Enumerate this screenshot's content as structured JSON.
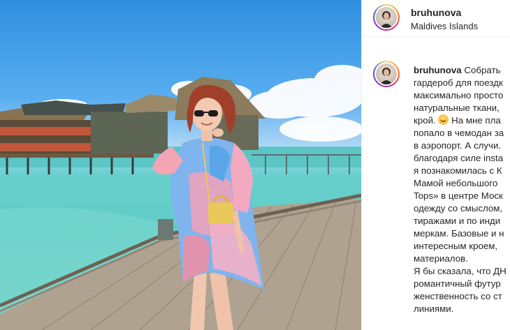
{
  "post": {
    "username": "bruhunova",
    "location": "Maldives Islands"
  },
  "caption": {
    "username": "bruhunova",
    "lines": [
      "Собрать",
      "гардероб для поездк",
      "максимально просто",
      "натуральные ткани,",
      "крой.",
      "На мне пла",
      "попало в чемодан за",
      "в аэропорт. А случи.",
      "благодаря силе insta",
      "я познакомилась с К",
      "Мамой небольшого",
      "Tops» в центре Моск",
      "одежду со смыслом,",
      "тиражами и по инди",
      "меркам. Базовые и н",
      "интересным кроем,",
      "материалов.",
      "Я бы сказала, что ДН",
      "романтичный футур",
      "женственность со ст",
      "линиями."
    ]
  },
  "icons": {
    "avatar": "profile-avatar",
    "emoji": "smiling-face-emoji"
  }
}
